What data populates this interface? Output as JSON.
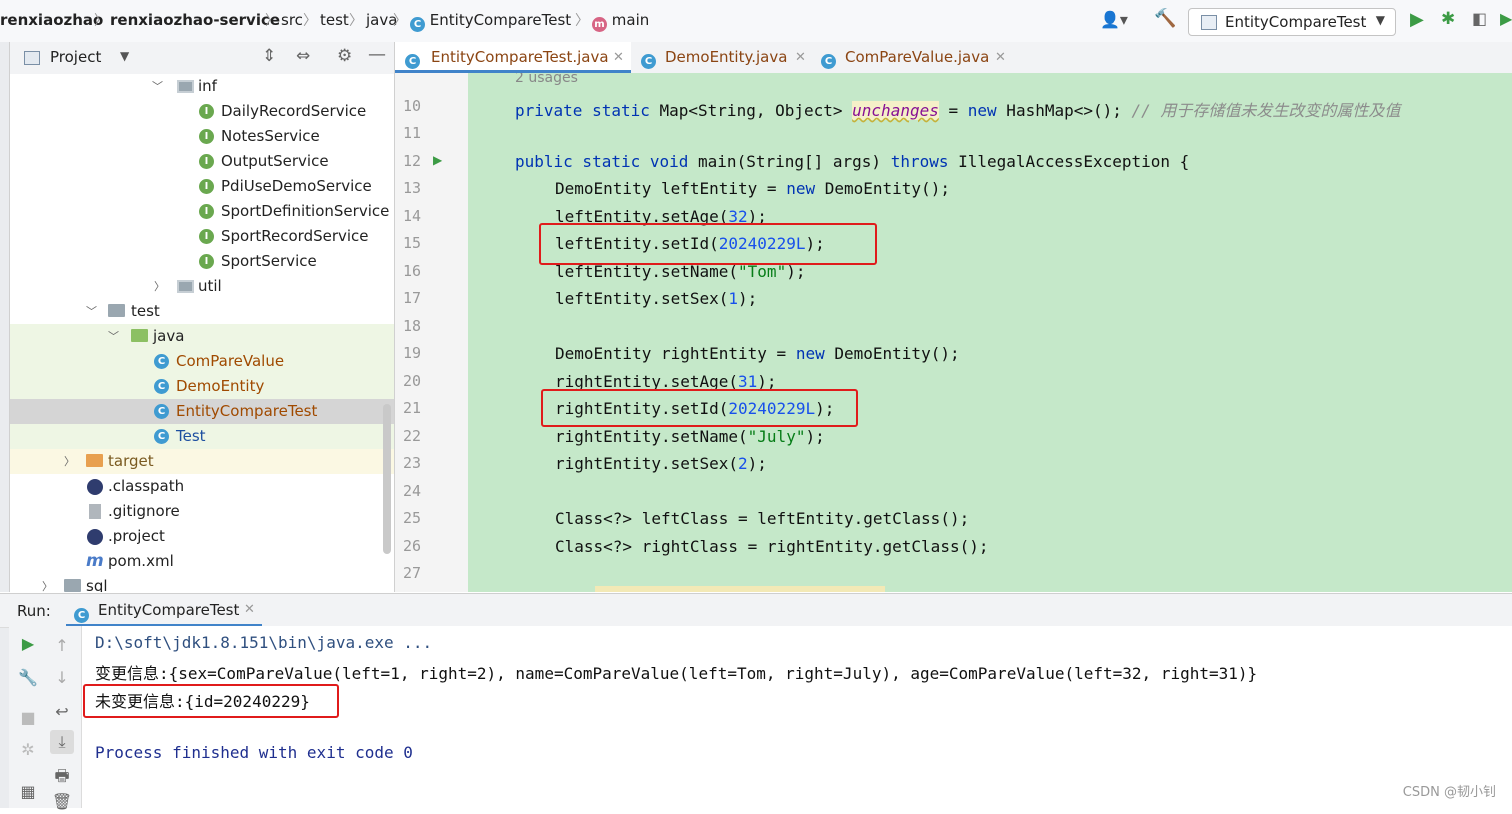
{
  "breadcrumb": {
    "items": [
      "renxiaozhao",
      "renxiaozhao-service",
      "src",
      "test",
      "java",
      "EntityCompareTest",
      "main"
    ]
  },
  "toolbar": {
    "run_config": "EntityCompareTest"
  },
  "project_panel": {
    "title": "Project",
    "tree": [
      {
        "label": "inf",
        "type": "package",
        "expanded": true
      },
      {
        "label": "DailyRecordService",
        "type": "interface"
      },
      {
        "label": "NotesService",
        "type": "interface"
      },
      {
        "label": "OutputService",
        "type": "interface"
      },
      {
        "label": "PdiUseDemoService",
        "type": "interface"
      },
      {
        "label": "SportDefinitionService",
        "type": "interface"
      },
      {
        "label": "SportRecordService",
        "type": "interface"
      },
      {
        "label": "SportService",
        "type": "interface"
      },
      {
        "label": "util",
        "type": "package",
        "expanded": false
      },
      {
        "label": "test",
        "type": "folder",
        "expanded": true
      },
      {
        "label": "java",
        "type": "source-folder",
        "expanded": true
      },
      {
        "label": "ComPareValue",
        "type": "class"
      },
      {
        "label": "DemoEntity",
        "type": "class"
      },
      {
        "label": "EntityCompareTest",
        "type": "test-class",
        "selected": true
      },
      {
        "label": "Test",
        "type": "test-class"
      },
      {
        "label": "target",
        "type": "excluded-folder",
        "expanded": false
      },
      {
        "label": ".classpath",
        "type": "eclipse-file"
      },
      {
        "label": ".gitignore",
        "type": "git-file"
      },
      {
        "label": ".project",
        "type": "eclipse-file"
      },
      {
        "label": "pom.xml",
        "type": "maven-file"
      },
      {
        "label": "sql",
        "type": "folder",
        "expanded": false
      }
    ]
  },
  "editor": {
    "tabs": [
      {
        "label": "EntityCompareTest.java",
        "active": true
      },
      {
        "label": "DemoEntity.java",
        "active": false
      },
      {
        "label": "ComPareValue.java",
        "active": false
      }
    ],
    "usages_hint": "2 usages",
    "line_numbers": [
      "10",
      "11",
      "12",
      "13",
      "14",
      "15",
      "16",
      "17",
      "18",
      "19",
      "20",
      "21",
      "22",
      "23",
      "24",
      "25",
      "26",
      "27"
    ],
    "code_lines": {
      "l10a": "private static ",
      "l10b": "Map<String, Object> ",
      "l10field": "unchanges",
      "l10c": " = ",
      "l10new": "new",
      "l10d": " HashMap<>(); ",
      "l10comment": "// 用于存储值未发生改变的属性及值",
      "l12kw": "public static void ",
      "l12a": "main(String[] args) ",
      "l12throws": "throws",
      "l12b": " IllegalAccessException {",
      "l13a": "DemoEntity leftEntity = ",
      "l13new": "new",
      "l13b": " DemoEntity();",
      "l14a": "leftEntity.setAge(",
      "l14num": "32",
      "l14b": ");",
      "l15a": "leftEntity.setId(",
      "l15num": "20240229L",
      "l15b": ");",
      "l16a": "leftEntity.setName(",
      "l16str": "\"Tom\"",
      "l16b": ");",
      "l17a": "leftEntity.setSex(",
      "l17num": "1",
      "l17b": ");",
      "l19a": "DemoEntity rightEntity = ",
      "l19new": "new",
      "l19b": " DemoEntity();",
      "l20a": "rightEntity.setAge(",
      "l20num": "31",
      "l20b": ");",
      "l21a": "rightEntity.setId(",
      "l21num": "20240229L",
      "l21b": ");",
      "l22a": "rightEntity.setName(",
      "l22str": "\"July\"",
      "l22b": ");",
      "l23a": "rightEntity.setSex(",
      "l23num": "2",
      "l23b": ");",
      "l25": "Class<?> leftClass = leftEntity.getClass();",
      "l26": "Class<?> rightClass = rightEntity.getClass();"
    }
  },
  "run_panel": {
    "label": "Run:",
    "tab": "EntityCompareTest",
    "console": [
      "D:\\soft\\jdk1.8.151\\bin\\java.exe ...",
      "变更信息:{sex=ComPareValue(left=1, right=2), name=ComPareValue(left=Tom, right=July), age=ComPareValue(left=32, right=31)}",
      "未变更信息:{id=20240229}",
      "Process finished with exit code 0"
    ]
  },
  "watermark": "CSDN @韧小钊",
  "colors": {
    "code_background": "#c5e8c9",
    "annotation_red": "#e01b1b",
    "keyword": "#0033b3",
    "number": "#1750eb",
    "string": "#067d17"
  }
}
